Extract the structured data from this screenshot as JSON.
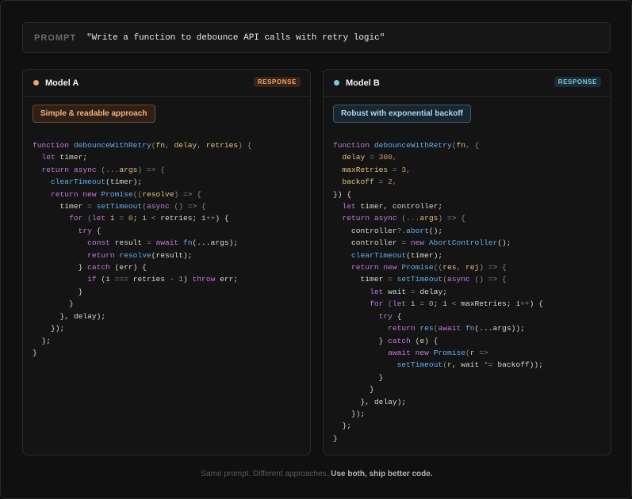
{
  "prompt": {
    "label": "PROMPT",
    "text": "\"Write a function to debounce API calls with retry logic\""
  },
  "colors": {
    "model_a_dot": "#f0a46a",
    "model_b_dot": "#7cc6e0",
    "keyword": "#c678dd",
    "function": "#61afef",
    "param": "#e5c07b",
    "number": "#d19a66"
  },
  "model_a": {
    "name": "Model A",
    "badge": "RESPONSE",
    "approach": "Simple & readable approach",
    "code": [
      [
        [
          "kw",
          "function "
        ],
        [
          "fn",
          "debounceWithRetry"
        ],
        [
          "op",
          "("
        ],
        [
          "pm",
          "fn"
        ],
        [
          "op",
          ", "
        ],
        [
          "pm",
          "delay"
        ],
        [
          "op",
          ", "
        ],
        [
          "pm",
          "retries"
        ],
        [
          "op",
          ") {"
        ]
      ],
      [
        [
          "tx",
          "  "
        ],
        [
          "kw",
          "let "
        ],
        [
          "tx",
          "timer;"
        ]
      ],
      [
        [
          "tx",
          "  "
        ],
        [
          "kw",
          "return async "
        ],
        [
          "op",
          "(..."
        ],
        [
          "pm",
          "args"
        ],
        [
          "op",
          ") => {"
        ]
      ],
      [
        [
          "tx",
          "    "
        ],
        [
          "fn",
          "clearTimeout"
        ],
        [
          "tx",
          "(timer);"
        ]
      ],
      [
        [
          "tx",
          "    "
        ],
        [
          "kw",
          "return new "
        ],
        [
          "fn",
          "Promise"
        ],
        [
          "op",
          "(("
        ],
        [
          "pm",
          "resolve"
        ],
        [
          "op",
          ") => {"
        ]
      ],
      [
        [
          "tx",
          "      timer "
        ],
        [
          "op",
          "= "
        ],
        [
          "fn",
          "setTimeout"
        ],
        [
          "op",
          "("
        ],
        [
          "kw",
          "async "
        ],
        [
          "op",
          "() => {"
        ]
      ],
      [
        [
          "tx",
          "        "
        ],
        [
          "kw",
          "for "
        ],
        [
          "op",
          "("
        ],
        [
          "kw",
          "let "
        ],
        [
          "tx",
          "i "
        ],
        [
          "op",
          "= "
        ],
        [
          "nu",
          "0"
        ],
        [
          "tx",
          "; i "
        ],
        [
          "op",
          "< "
        ],
        [
          "tx",
          "retries; i"
        ],
        [
          "op",
          "++"
        ],
        [
          "tx",
          ") {"
        ]
      ],
      [
        [
          "tx",
          "          "
        ],
        [
          "kw",
          "try "
        ],
        [
          "tx",
          "{"
        ]
      ],
      [
        [
          "tx",
          "            "
        ],
        [
          "kw",
          "const "
        ],
        [
          "tx",
          "result "
        ],
        [
          "op",
          "= "
        ],
        [
          "kw",
          "await "
        ],
        [
          "fn",
          "fn"
        ],
        [
          "tx",
          "(...args);"
        ]
      ],
      [
        [
          "tx",
          "            "
        ],
        [
          "kw",
          "return "
        ],
        [
          "fn",
          "resolve"
        ],
        [
          "tx",
          "(result);"
        ]
      ],
      [
        [
          "tx",
          "          } "
        ],
        [
          "kw",
          "catch "
        ],
        [
          "tx",
          "(err) {"
        ]
      ],
      [
        [
          "tx",
          "            "
        ],
        [
          "kw",
          "if "
        ],
        [
          "tx",
          "(i "
        ],
        [
          "op",
          "=== "
        ],
        [
          "tx",
          "retries "
        ],
        [
          "op",
          "- "
        ],
        [
          "nu",
          "1"
        ],
        [
          "tx",
          ") "
        ],
        [
          "kw",
          "throw "
        ],
        [
          "tx",
          "err;"
        ]
      ],
      [
        [
          "tx",
          "          }"
        ]
      ],
      [
        [
          "tx",
          "        }"
        ]
      ],
      [
        [
          "tx",
          "      }, delay);"
        ]
      ],
      [
        [
          "tx",
          "    });"
        ]
      ],
      [
        [
          "tx",
          "  };"
        ]
      ],
      [
        [
          "tx",
          "}"
        ]
      ]
    ]
  },
  "model_b": {
    "name": "Model B",
    "badge": "RESPONSE",
    "approach": "Robust with exponential backoff",
    "code": [
      [
        [
          "kw",
          "function "
        ],
        [
          "fn",
          "debounceWithRetry"
        ],
        [
          "op",
          "("
        ],
        [
          "pm",
          "fn"
        ],
        [
          "op",
          ", {"
        ]
      ],
      [
        [
          "tx",
          "  "
        ],
        [
          "pm",
          "delay "
        ],
        [
          "op",
          "= "
        ],
        [
          "nu",
          "300"
        ],
        [
          "op",
          ","
        ]
      ],
      [
        [
          "tx",
          "  "
        ],
        [
          "pm",
          "maxRetries "
        ],
        [
          "op",
          "= "
        ],
        [
          "nu",
          "3"
        ],
        [
          "op",
          ","
        ]
      ],
      [
        [
          "tx",
          "  "
        ],
        [
          "pm",
          "backoff "
        ],
        [
          "op",
          "= "
        ],
        [
          "nu",
          "2"
        ],
        [
          "op",
          ","
        ]
      ],
      [
        [
          "tx",
          "}) {"
        ]
      ],
      [
        [
          "tx",
          "  "
        ],
        [
          "kw",
          "let "
        ],
        [
          "tx",
          "timer, controller;"
        ]
      ],
      [
        [
          "tx",
          "  "
        ],
        [
          "kw",
          "return async "
        ],
        [
          "op",
          "(..."
        ],
        [
          "pm",
          "args"
        ],
        [
          "op",
          ") => {"
        ]
      ],
      [
        [
          "tx",
          "    controller"
        ],
        [
          "op",
          "?."
        ],
        [
          "fn",
          "abort"
        ],
        [
          "tx",
          "();"
        ]
      ],
      [
        [
          "tx",
          "    controller "
        ],
        [
          "op",
          "= "
        ],
        [
          "kw",
          "new "
        ],
        [
          "fn",
          "AbortController"
        ],
        [
          "tx",
          "();"
        ]
      ],
      [
        [
          "tx",
          "    "
        ],
        [
          "fn",
          "clearTimeout"
        ],
        [
          "tx",
          "(timer);"
        ]
      ],
      [
        [
          "tx",
          "    "
        ],
        [
          "kw",
          "return new "
        ],
        [
          "fn",
          "Promise"
        ],
        [
          "op",
          "(("
        ],
        [
          "pm",
          "res"
        ],
        [
          "op",
          ", "
        ],
        [
          "pm",
          "rej"
        ],
        [
          "op",
          ") => {"
        ]
      ],
      [
        [
          "tx",
          "      timer "
        ],
        [
          "op",
          "= "
        ],
        [
          "fn",
          "setTimeout"
        ],
        [
          "op",
          "("
        ],
        [
          "kw",
          "async "
        ],
        [
          "op",
          "() => {"
        ]
      ],
      [
        [
          "tx",
          "        "
        ],
        [
          "kw",
          "let "
        ],
        [
          "tx",
          "wait "
        ],
        [
          "op",
          "= "
        ],
        [
          "tx",
          "delay;"
        ]
      ],
      [
        [
          "tx",
          "        "
        ],
        [
          "kw",
          "for "
        ],
        [
          "op",
          "("
        ],
        [
          "kw",
          "let "
        ],
        [
          "tx",
          "i "
        ],
        [
          "op",
          "= "
        ],
        [
          "nu",
          "0"
        ],
        [
          "tx",
          "; i "
        ],
        [
          "op",
          "< "
        ],
        [
          "tx",
          "maxRetries; i"
        ],
        [
          "op",
          "++"
        ],
        [
          "tx",
          ") {"
        ]
      ],
      [
        [
          "tx",
          "          "
        ],
        [
          "kw",
          "try "
        ],
        [
          "tx",
          "{"
        ]
      ],
      [
        [
          "tx",
          "            "
        ],
        [
          "kw",
          "return "
        ],
        [
          "fn",
          "res"
        ],
        [
          "op",
          "("
        ],
        [
          "kw",
          "await "
        ],
        [
          "fn",
          "fn"
        ],
        [
          "tx",
          "(...args));"
        ]
      ],
      [
        [
          "tx",
          "          } "
        ],
        [
          "kw",
          "catch "
        ],
        [
          "tx",
          "(e) {"
        ]
      ],
      [
        [
          "tx",
          "            "
        ],
        [
          "kw",
          "await new "
        ],
        [
          "fn",
          "Promise"
        ],
        [
          "op",
          "("
        ],
        [
          "pm",
          "r "
        ],
        [
          "op",
          "=>"
        ]
      ],
      [
        [
          "tx",
          "              "
        ],
        [
          "fn",
          "setTimeout"
        ],
        [
          "op",
          "("
        ],
        [
          "pm",
          "r"
        ],
        [
          "tx",
          ", wait "
        ],
        [
          "op",
          "*= "
        ],
        [
          "tx",
          "backoff));"
        ]
      ],
      [
        [
          "tx",
          "          }"
        ]
      ],
      [
        [
          "tx",
          "        }"
        ]
      ],
      [
        [
          "tx",
          "      }, delay);"
        ]
      ],
      [
        [
          "tx",
          "    });"
        ]
      ],
      [
        [
          "tx",
          "  };"
        ]
      ],
      [
        [
          "tx",
          "}"
        ]
      ]
    ]
  },
  "footer": {
    "muted": "Same prompt. Different approaches.",
    "strong": "Use both, ship better code."
  }
}
